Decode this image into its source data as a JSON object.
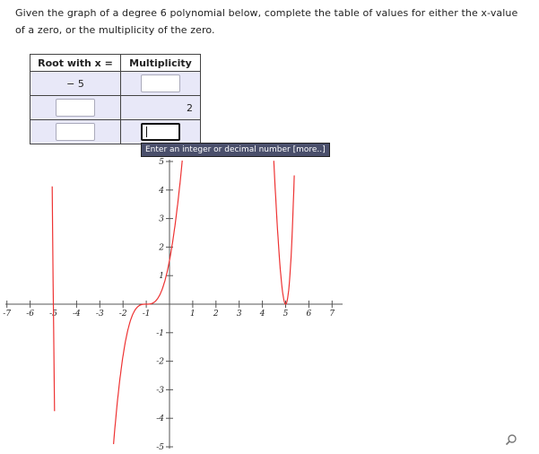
{
  "question": "Given the graph of a degree 6 polynomial below, complete the table of values for either the x-value of a zero, or the multiplicity of the zero.",
  "table": {
    "headers": [
      "Root with x =",
      "Multiplicity"
    ],
    "rows": [
      {
        "root": "− 5",
        "multiplicity": ""
      },
      {
        "root": "",
        "multiplicity": "2"
      },
      {
        "root": "",
        "multiplicity": ""
      }
    ]
  },
  "tooltip": "Enter an integer or decimal number [more..]",
  "graph": {
    "x_ticks": [
      "-7",
      "-6",
      "-5",
      "-4",
      "-3",
      "-2",
      "-1",
      "1",
      "2",
      "3",
      "4",
      "5",
      "6",
      "7"
    ],
    "y_ticks": [
      "5",
      "4",
      "3",
      "2",
      "1",
      "-1",
      "-2",
      "-3",
      "-4",
      "-5"
    ],
    "curve_color": "#ee3333"
  },
  "icons": {
    "zoom": "magnifier-icon"
  }
}
